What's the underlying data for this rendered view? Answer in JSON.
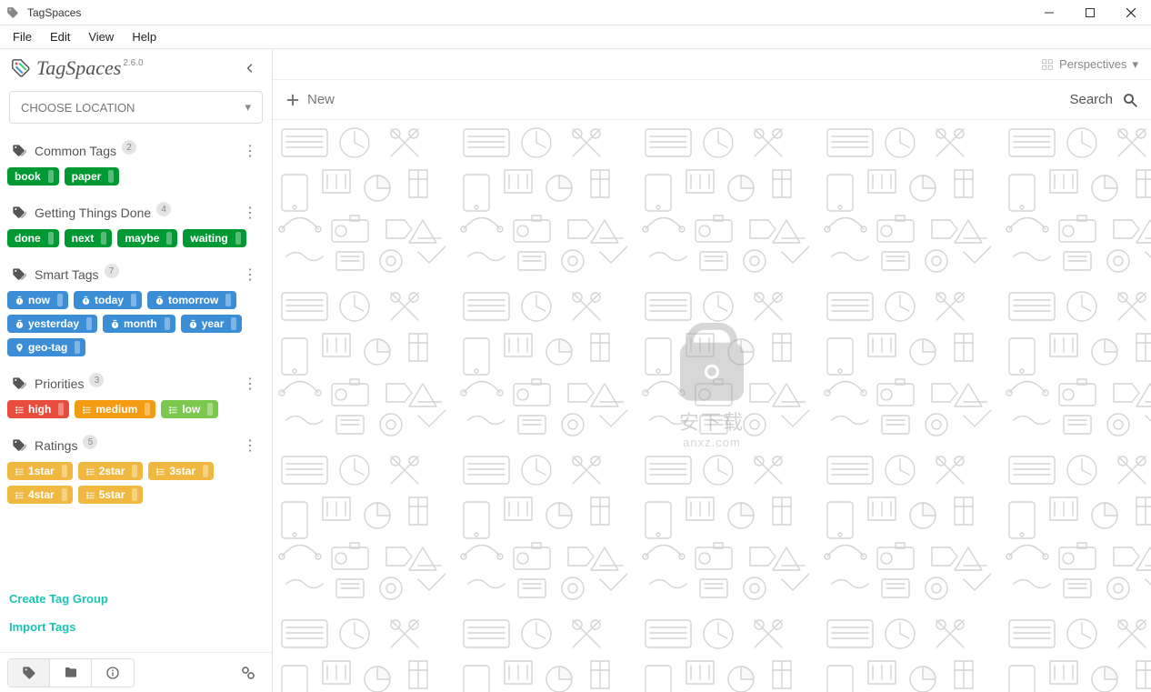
{
  "window": {
    "title": "TagSpaces"
  },
  "menubar": [
    "File",
    "Edit",
    "View",
    "Help"
  ],
  "brand": {
    "name": "TagSpaces",
    "version": "2.6.0"
  },
  "location": {
    "label": "CHOOSE LOCATION"
  },
  "groups": [
    {
      "name": "Common Tags",
      "count": "2",
      "tags": [
        {
          "label": "book",
          "color": "green"
        },
        {
          "label": "paper",
          "color": "green"
        }
      ]
    },
    {
      "name": "Getting Things Done",
      "count": "4",
      "tags": [
        {
          "label": "done",
          "color": "green"
        },
        {
          "label": "next",
          "color": "green"
        },
        {
          "label": "maybe",
          "color": "green"
        },
        {
          "label": "waiting",
          "color": "green"
        }
      ]
    },
    {
      "name": "Smart Tags",
      "count": "7",
      "tags": [
        {
          "label": "now",
          "color": "blue",
          "icon": "time"
        },
        {
          "label": "today",
          "color": "blue",
          "icon": "time"
        },
        {
          "label": "tomorrow",
          "color": "blue",
          "icon": "time"
        },
        {
          "label": "yesterday",
          "color": "blue",
          "icon": "time"
        },
        {
          "label": "month",
          "color": "blue",
          "icon": "time"
        },
        {
          "label": "year",
          "color": "blue",
          "icon": "time"
        },
        {
          "label": "geo-tag",
          "color": "blue",
          "icon": "pin"
        }
      ]
    },
    {
      "name": "Priorities",
      "count": "3",
      "tags": [
        {
          "label": "high",
          "color": "red",
          "icon": "list"
        },
        {
          "label": "medium",
          "color": "orange",
          "icon": "list"
        },
        {
          "label": "low",
          "color": "lime",
          "icon": "list"
        }
      ]
    },
    {
      "name": "Ratings",
      "count": "5",
      "tags": [
        {
          "label": "1star",
          "color": "yellow",
          "icon": "list"
        },
        {
          "label": "2star",
          "color": "yellow",
          "icon": "list"
        },
        {
          "label": "3star",
          "color": "yellow",
          "icon": "list"
        },
        {
          "label": "4star",
          "color": "yellow",
          "icon": "list"
        },
        {
          "label": "5star",
          "color": "yellow",
          "icon": "list"
        }
      ]
    }
  ],
  "sidebarActions": {
    "createGroup": "Create Tag Group",
    "importTags": "Import Tags"
  },
  "mainTop": {
    "perspectives": "Perspectives"
  },
  "toolbar": {
    "new": "New",
    "search": "Search"
  },
  "watermark": {
    "line1": "安下载",
    "line2": "anxz.com"
  }
}
